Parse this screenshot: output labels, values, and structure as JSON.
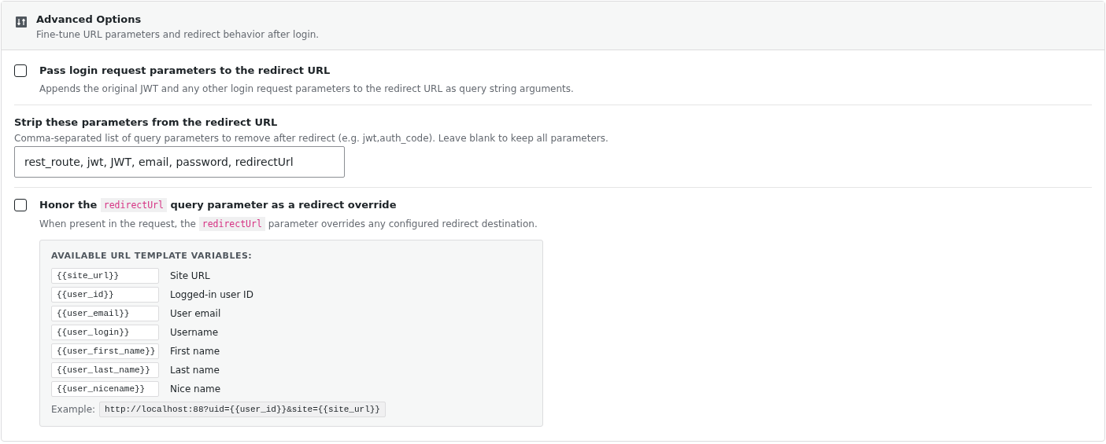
{
  "header": {
    "title": "Advanced Options",
    "subtitle": "Fine-tune URL parameters and redirect behavior after login."
  },
  "settings": [
    {
      "kind": "checkbox",
      "checked": false,
      "label": [
        {
          "kind": "text",
          "text": "Pass login request parameters to the redirect URL"
        }
      ],
      "description": [
        {
          "kind": "text",
          "text": "Appends the original JWT and any other login request parameters to the redirect URL as query string arguments."
        }
      ]
    },
    {
      "kind": "text-field",
      "label": "Strip these parameters from the redirect URL",
      "description": "Comma-separated list of query parameters to remove after redirect (e.g. jwt,auth_code). Leave blank to keep all parameters.",
      "value": "rest_route, jwt, JWT, email, password, redirectUrl"
    },
    {
      "kind": "checkbox",
      "checked": false,
      "label": [
        {
          "kind": "text",
          "text": "Honor the"
        },
        {
          "kind": "code",
          "text": "redirectUrl"
        },
        {
          "kind": "text",
          "text": "query parameter as a redirect override"
        }
      ],
      "description": [
        {
          "kind": "text",
          "text": "When present in the request, the"
        },
        {
          "kind": "code",
          "text": "redirectUrl"
        },
        {
          "kind": "text",
          "text": "parameter overrides any configured redirect destination."
        }
      ],
      "variables": {
        "title": "AVAILABLE URL TEMPLATE VARIABLES:",
        "items": [
          {
            "token": "{{site_url}}",
            "meaning": "Site URL"
          },
          {
            "token": "{{user_id}}",
            "meaning": "Logged-in user ID"
          },
          {
            "token": "{{user_email}}",
            "meaning": "User email"
          },
          {
            "token": "{{user_login}}",
            "meaning": "Username"
          },
          {
            "token": "{{user_first_name}}",
            "meaning": "First name"
          },
          {
            "token": "{{user_last_name}}",
            "meaning": "Last name"
          },
          {
            "token": "{{user_nicename}}",
            "meaning": "Nice name"
          }
        ],
        "example_label": "Example:",
        "example": "http://localhost:88?uid={{user_id}}&site={{site_url}}"
      }
    }
  ]
}
